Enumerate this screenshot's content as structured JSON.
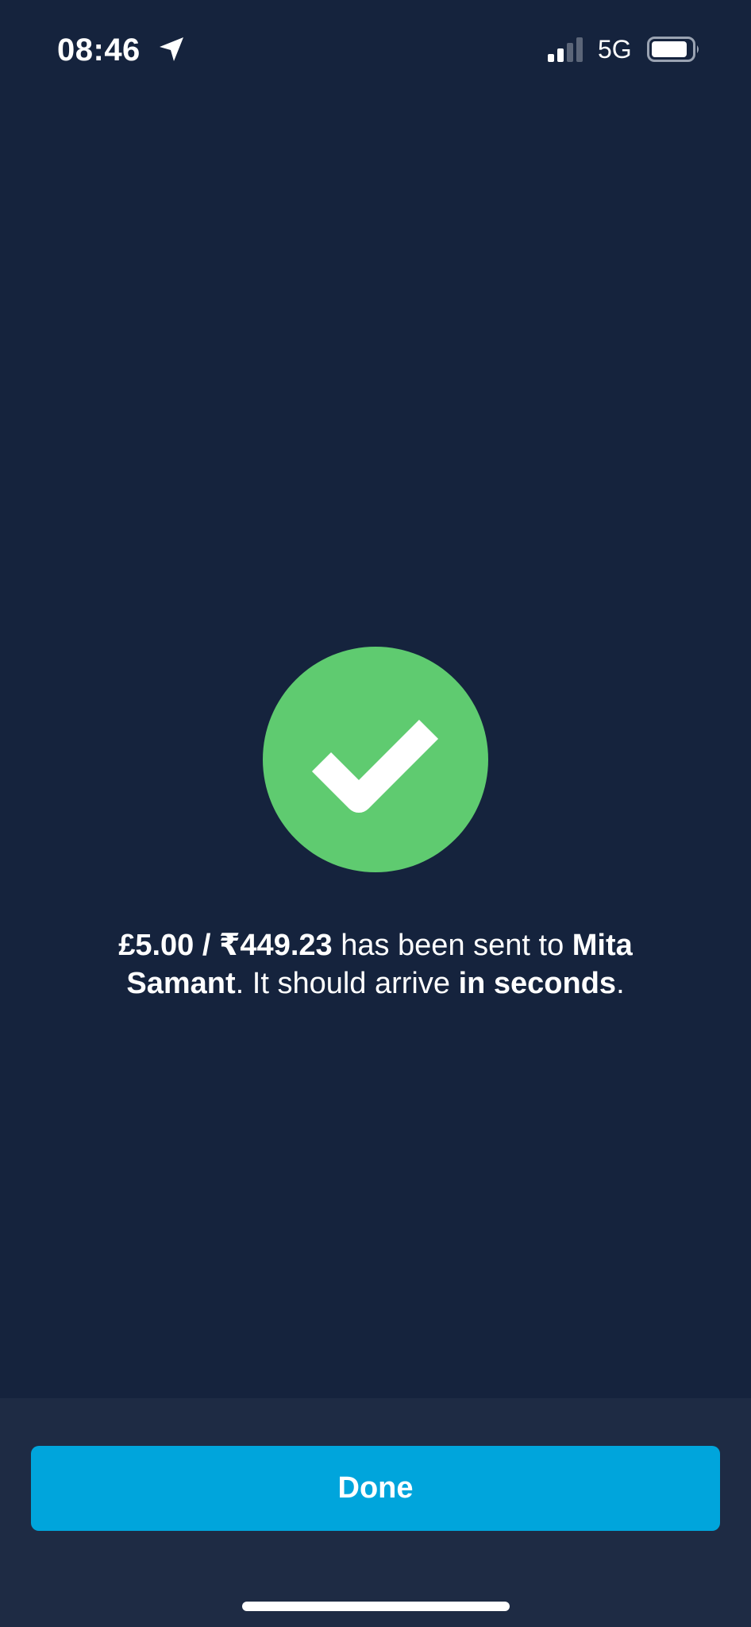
{
  "status_bar": {
    "time": "08:46",
    "network": "5G",
    "location_icon": "location-arrow-icon",
    "signal_icon": "cellular-signal-icon",
    "battery_icon": "battery-icon"
  },
  "confirmation": {
    "icon": "check-circle-icon",
    "amount": "£5.00 / ₹449.23",
    "text_sent_to": " has been sent to ",
    "recipient": "Mita Samant",
    "text_arrive": ". It should arrive ",
    "arrival": "in seconds",
    "text_end": "."
  },
  "footer": {
    "done_label": "Done"
  },
  "colors": {
    "background": "#15233d",
    "footer_background": "#1e2b44",
    "success_green": "#5fcb70",
    "button_blue": "#00a5dc",
    "text": "#ffffff"
  }
}
